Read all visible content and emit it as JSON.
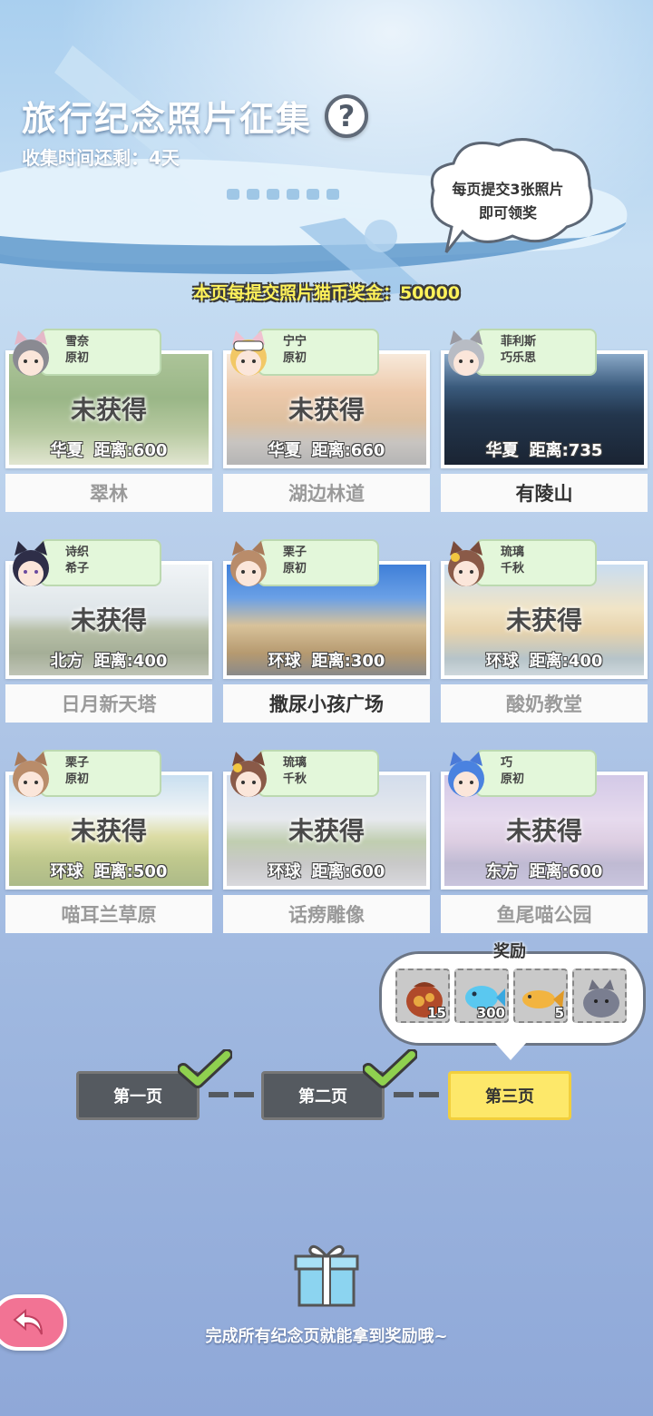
{
  "header": {
    "title": "旅行纪念照片征集",
    "help_label": "?",
    "timer_label": "收集时间还剩：4天"
  },
  "speech_bubble": {
    "line1": "每页提交3张照片",
    "line2": "即可领奖"
  },
  "bonus_text": "本页每提交照片猫币奖金：50000",
  "locked_label": "未获得",
  "photos": [
    {
      "name": "翠林",
      "region": "华夏",
      "distance": "距离:600",
      "cat1": "雪奈",
      "cat2": "原初",
      "obtained": false
    },
    {
      "name": "湖边林道",
      "region": "华夏",
      "distance": "距离:660",
      "cat1": "宁宁",
      "cat2": "原初",
      "obtained": false
    },
    {
      "name": "有陵山",
      "region": "华夏",
      "distance": "距离:735",
      "cat1": "菲利斯",
      "cat2": "巧乐思",
      "obtained": true
    },
    {
      "name": "日月新天塔",
      "region": "北方",
      "distance": "距离:400",
      "cat1": "诗织",
      "cat2": "希子",
      "obtained": false
    },
    {
      "name": "撒尿小孩广场",
      "region": "环球",
      "distance": "距离:300",
      "cat1": "栗子",
      "cat2": "原初",
      "obtained": true
    },
    {
      "name": "酸奶教堂",
      "region": "环球",
      "distance": "距离:400",
      "cat1": "琉璃",
      "cat2": "千秋",
      "obtained": false
    },
    {
      "name": "喵耳兰草原",
      "region": "环球",
      "distance": "距离:500",
      "cat1": "栗子",
      "cat2": "原初",
      "obtained": false
    },
    {
      "name": "话痨雕像",
      "region": "环球",
      "distance": "距离:600",
      "cat1": "琉璃",
      "cat2": "千秋",
      "obtained": false
    },
    {
      "name": "鱼尾喵公园",
      "region": "东方",
      "distance": "距离:600",
      "cat1": "巧",
      "cat2": "原初",
      "obtained": false
    }
  ],
  "rewards": {
    "title": "奖励",
    "items": [
      {
        "icon": "treasure-bag-icon",
        "count": "15"
      },
      {
        "icon": "blue-fish-icon",
        "count": "300"
      },
      {
        "icon": "golden-fish-icon",
        "count": "5"
      },
      {
        "icon": "gray-cat-icon",
        "count": ""
      }
    ]
  },
  "pages": [
    {
      "label": "第一页",
      "completed": true
    },
    {
      "label": "第二页",
      "completed": true
    },
    {
      "label": "第三页",
      "completed": false,
      "active": true
    }
  ],
  "footer": {
    "text": "完成所有纪念页就能拿到奖励哦~"
  },
  "colors": {
    "accent_yellow": "#fde86a",
    "tag_green": "#e3f7da",
    "back_pink": "#f27394",
    "check_green": "#8fd14f"
  }
}
